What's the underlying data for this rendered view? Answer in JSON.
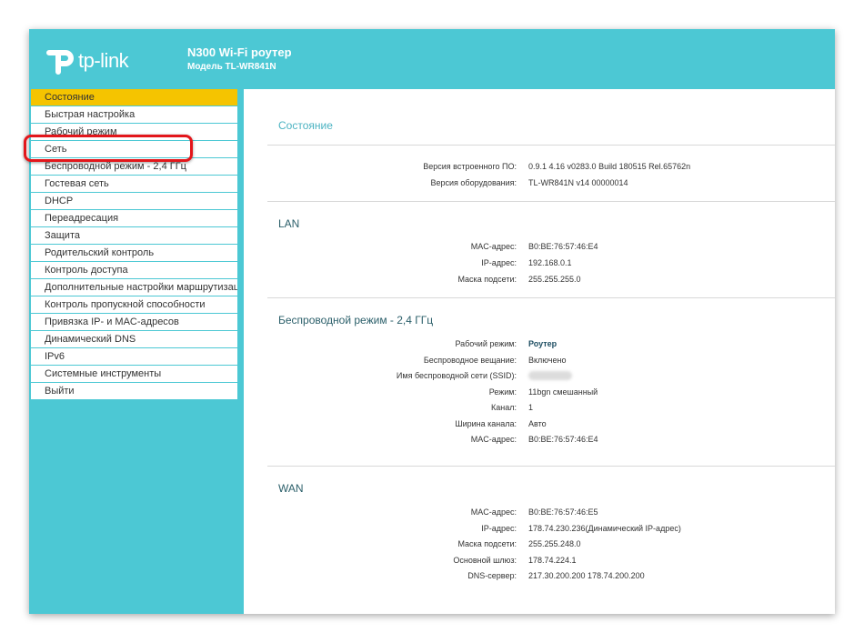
{
  "header": {
    "logo_text": "tp-link",
    "product_title": "N300 Wi-Fi роутер",
    "model_line": "Модель TL-WR841N"
  },
  "sidebar": {
    "items": [
      {
        "label": "Состояние",
        "active": true
      },
      {
        "label": "Быстрая настройка"
      },
      {
        "label": "Рабочий режим"
      },
      {
        "label": "Сеть"
      },
      {
        "label": "Беспроводной режим - 2,4 ГГц"
      },
      {
        "label": "Гостевая сеть"
      },
      {
        "label": "DHCP"
      },
      {
        "label": "Переадресация"
      },
      {
        "label": "Защита"
      },
      {
        "label": "Родительский контроль"
      },
      {
        "label": "Контроль доступа"
      },
      {
        "label": "Дополнительные настройки маршрутизации"
      },
      {
        "label": "Контроль пропускной способности"
      },
      {
        "label": "Привязка IP- и MAC-адресов"
      },
      {
        "label": "Динамический DNS"
      },
      {
        "label": "IPv6"
      },
      {
        "label": "Системные инструменты"
      },
      {
        "label": "Выйти"
      }
    ]
  },
  "content": {
    "status_title": "Состояние",
    "firmware": {
      "fw_label": "Версия встроенного ПО:",
      "fw_value": "0.9.1 4.16 v0283.0 Build 180515 Rel.65762n",
      "hw_label": "Версия оборудования:",
      "hw_value": "TL-WR841N v14 00000014"
    },
    "lan": {
      "title": "LAN",
      "mac_label": "MAC-адрес:",
      "mac_value": "B0:BE:76:57:46:E4",
      "ip_label": "IP-адрес:",
      "ip_value": "192.168.0.1",
      "mask_label": "Маска подсети:",
      "mask_value": "255.255.255.0"
    },
    "wireless": {
      "title": "Беспроводной режим - 2,4 ГГц",
      "mode_label": "Рабочий режим:",
      "mode_value": "Роутер",
      "broadcast_label": "Беспроводное вещание:",
      "broadcast_value": "Включено",
      "ssid_label": "Имя беспроводной сети (SSID):",
      "radio_mode_label": "Режим:",
      "radio_mode_value": "11bgn смешанный",
      "channel_label": "Канал:",
      "channel_value": "1",
      "width_label": "Ширина канала:",
      "width_value": "Авто",
      "mac_label": "MAC-адрес:",
      "mac_value": "B0:BE:76:57:46:E4"
    },
    "wan": {
      "title": "WAN",
      "mac_label": "MAC-адрес:",
      "mac_value": "B0:BE:76:57:46:E5",
      "ip_label": "IP-адрес:",
      "ip_value": "178.74.230.236(Динамический IP-адрес)",
      "mask_label": "Маска подсети:",
      "mask_value": "255.255.248.0",
      "gateway_label": "Основной шлюз:",
      "gateway_value": "178.74.224.1",
      "dns_label": "DNS-сервер:",
      "dns_value": "217.30.200.200 178.74.200.200"
    }
  },
  "colors": {
    "brand_teal": "#4cc8d4",
    "active_menu": "#f5c400",
    "highlight_ring": "#e3161b"
  }
}
